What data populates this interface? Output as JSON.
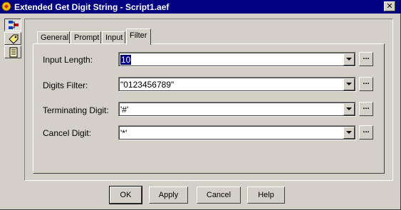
{
  "window": {
    "title": "Extended Get Digit String - Script1.aef",
    "close_label": "✕"
  },
  "side_toolbar": {
    "items": [
      {
        "icon": "hierarchy-icon",
        "active": true
      },
      {
        "icon": "tag-icon",
        "active": false
      },
      {
        "icon": "notes-icon",
        "active": false
      }
    ]
  },
  "tabs": [
    {
      "label": "General"
    },
    {
      "label": "Prompt"
    },
    {
      "label": "Input"
    },
    {
      "label": "Filter",
      "active": true
    }
  ],
  "fields": {
    "input_length": {
      "label": "Input Length:",
      "value": "10"
    },
    "digits_filter": {
      "label": "Digits Filter:",
      "value": "\"0123456789\""
    },
    "terminating_digit": {
      "label": "Terminating Digit:",
      "value": "'#'"
    },
    "cancel_digit": {
      "label": "Cancel Digit:",
      "value": "'*'"
    }
  },
  "ellipsis_label": "...",
  "buttons": {
    "ok": "OK",
    "apply": "Apply",
    "cancel": "Cancel",
    "help": "Help"
  },
  "colors": {
    "titlebar": "#000080",
    "face": "#d4d0c8",
    "selection": "#000080"
  }
}
